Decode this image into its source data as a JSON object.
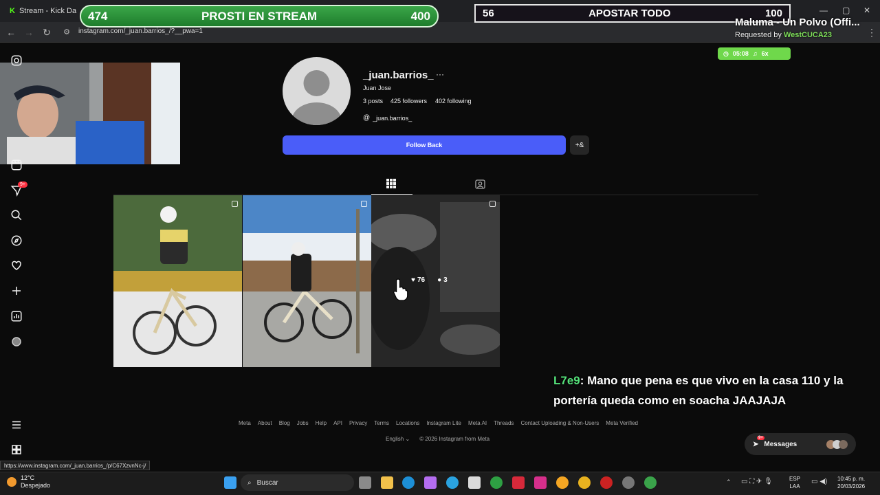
{
  "browser": {
    "tab_title": "Stream - Kick Da",
    "url": "instagram.com/_juan.barrios_/?__pwa=1",
    "status_url": "https://www.instagram.com/_juan.barrios_/p/C67XzvnNc-j/"
  },
  "profile": {
    "username": "_juan.barrios_",
    "more_icon": "···",
    "full_name": "Juan Jose",
    "posts": "3 posts",
    "followers": "425 followers",
    "following": "402 following",
    "threads_handle": "_juan.barrios_",
    "follow_button": "Follow Back",
    "add_user_icon": "+&"
  },
  "posts": [
    {
      "likes": "",
      "comments": ""
    },
    {
      "likes": "",
      "comments": ""
    },
    {
      "likes": "76",
      "comments": "3"
    }
  ],
  "sidebar": {
    "notif_badge": "9+"
  },
  "footer": {
    "links": [
      "Meta",
      "About",
      "Blog",
      "Jobs",
      "Help",
      "API",
      "Privacy",
      "Terms",
      "Locations",
      "Instagram Lite",
      "Meta AI",
      "Threads",
      "Contact Uploading & Non-Users",
      "Meta Verified"
    ],
    "language": "English",
    "copyright": "© 2026 Instagram from Meta"
  },
  "messages": {
    "label": "Messages",
    "badge": "9+"
  },
  "overlay": {
    "prosti_left": "474",
    "prosti_title": "PROSTI EN STREAM",
    "prosti_right": "400",
    "apostar_left": "56",
    "apostar_title": "APOSTAR TODO",
    "apostar_right": "100",
    "song": "Maluma - Un Polvo (Offi...",
    "requested_by_prefix": "Requested by",
    "requested_by": "WestCUCA23",
    "song_time": "05:08",
    "song_count": "6x",
    "chat_user": "L7e9",
    "chat_message": ": Mano que pena es que vivo en la casa 110 y la portería queda como en soacha JAAJAJA"
  },
  "taskbar": {
    "weather_temp": "12°C",
    "weather_desc": "Despejado",
    "search_placeholder": "Buscar",
    "lang_top": "ESP",
    "lang_bottom": "LAA",
    "time": "10:45 p. m.",
    "date": "20/03/2026"
  },
  "colors": {
    "follow_button": "#4a5df9",
    "prosti_bar": "#2e9a3e",
    "song_bar": "#6fd84b",
    "chat_name": "#55e27a"
  }
}
